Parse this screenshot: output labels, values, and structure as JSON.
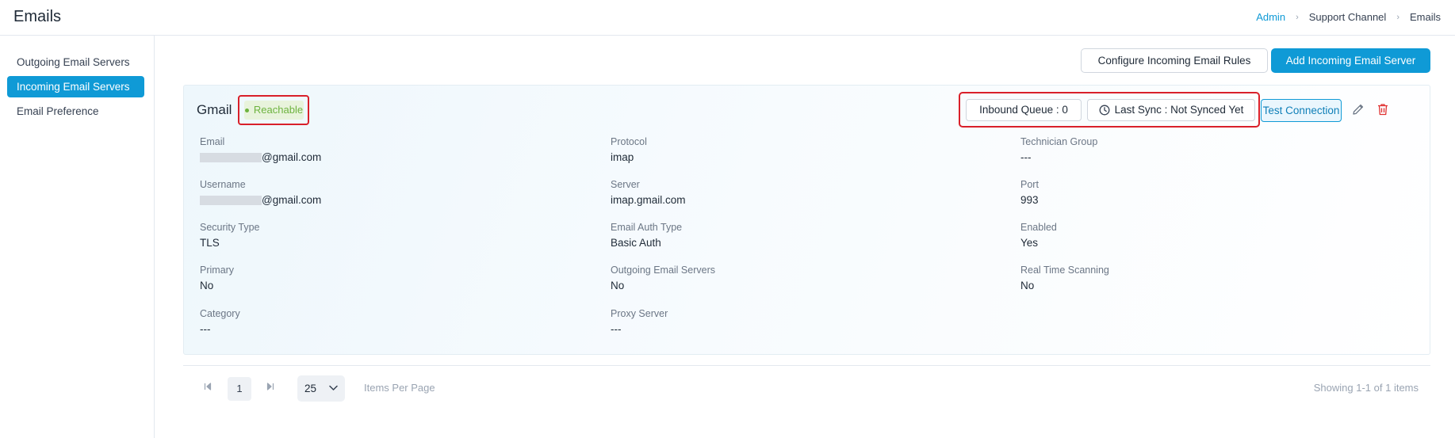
{
  "header": {
    "title": "Emails",
    "breadcrumb": [
      "Admin",
      "Support Channel",
      "Emails"
    ]
  },
  "sidebar": {
    "items": [
      {
        "label": "Outgoing Email Servers",
        "active": false
      },
      {
        "label": "Incoming Email Servers",
        "active": true
      },
      {
        "label": "Email Preference",
        "active": false
      }
    ]
  },
  "toolbar": {
    "configure_label": "Configure Incoming Email Rules",
    "add_label": "Add Incoming Email Server"
  },
  "server": {
    "name": "Gmail",
    "status": "Reachable",
    "inbound_queue": "Inbound Queue : 0",
    "last_sync": "Last Sync : Not Synced Yet",
    "test_label": "Test Connection",
    "fields": [
      {
        "label": "Email",
        "value": "@gmail.com",
        "masked": true
      },
      {
        "label": "Protocol",
        "value": "imap"
      },
      {
        "label": "Technician Group",
        "value": "---"
      },
      {
        "label": "Username",
        "value": "@gmail.com",
        "masked": true
      },
      {
        "label": "Server",
        "value": "imap.gmail.com"
      },
      {
        "label": "Port",
        "value": "993"
      },
      {
        "label": "Security Type",
        "value": "TLS"
      },
      {
        "label": "Email Auth Type",
        "value": "Basic Auth"
      },
      {
        "label": "Enabled",
        "value": "Yes"
      },
      {
        "label": "Primary",
        "value": "No"
      },
      {
        "label": "Outgoing Email Servers",
        "value": "No"
      },
      {
        "label": "Real Time Scanning",
        "value": "No"
      },
      {
        "label": "Category",
        "value": "---"
      },
      {
        "label": "Proxy Server",
        "value": "---"
      }
    ]
  },
  "pagination": {
    "current_page": "1",
    "per_page": "25",
    "per_page_label": "Items Per Page",
    "showing": "Showing 1-1 of 1 items"
  },
  "colors": {
    "accent": "#0f9ad6",
    "status_green": "#6db33f",
    "highlight_red": "#d9202a",
    "delete_red": "#e03131"
  }
}
